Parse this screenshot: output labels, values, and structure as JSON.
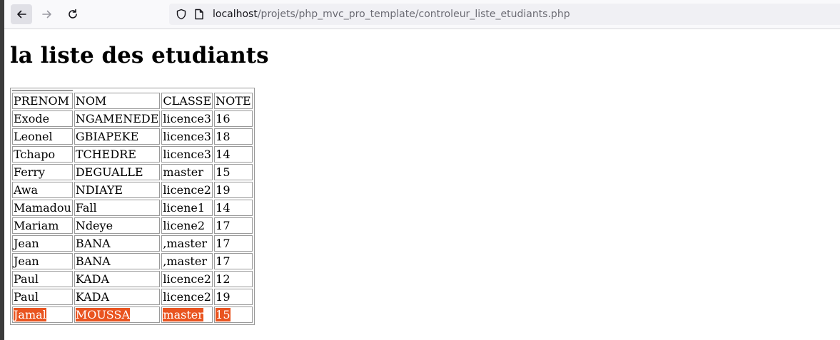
{
  "browser": {
    "url_host": "localhost",
    "url_path": "/projets/php_mvc_pro_template/controleur_liste_etudiants.php"
  },
  "page": {
    "title": "la liste des etudiants"
  },
  "table": {
    "headers": [
      "PRENOM",
      "NOM",
      "CLASSE",
      "NOTE"
    ],
    "rows": [
      [
        "Exode",
        "NGAMENEDE",
        "licence3",
        "16"
      ],
      [
        "Leonel",
        "GBIAPEKE",
        "licence3",
        "18"
      ],
      [
        "Tchapo",
        "TCHEDRE",
        "licence3",
        "14"
      ],
      [
        "Ferry",
        "DEGUALLE",
        "master",
        "15"
      ],
      [
        "Awa",
        "NDIAYE",
        "licence2",
        "19"
      ],
      [
        "Mamadou",
        "Fall",
        "licene1",
        "14"
      ],
      [
        "Mariam",
        "Ndeye",
        "licene2",
        "17"
      ],
      [
        "Jean",
        "BANA",
        ",master",
        "17"
      ],
      [
        "Jean",
        "BANA",
        ",master",
        "17"
      ],
      [
        "Paul",
        "KADA",
        "licence2",
        "12"
      ],
      [
        "Paul",
        "KADA",
        "licence2",
        "19"
      ],
      [
        "Jamal",
        "MOUSSA",
        "master",
        "15"
      ]
    ],
    "selection_color": "#e95420"
  }
}
